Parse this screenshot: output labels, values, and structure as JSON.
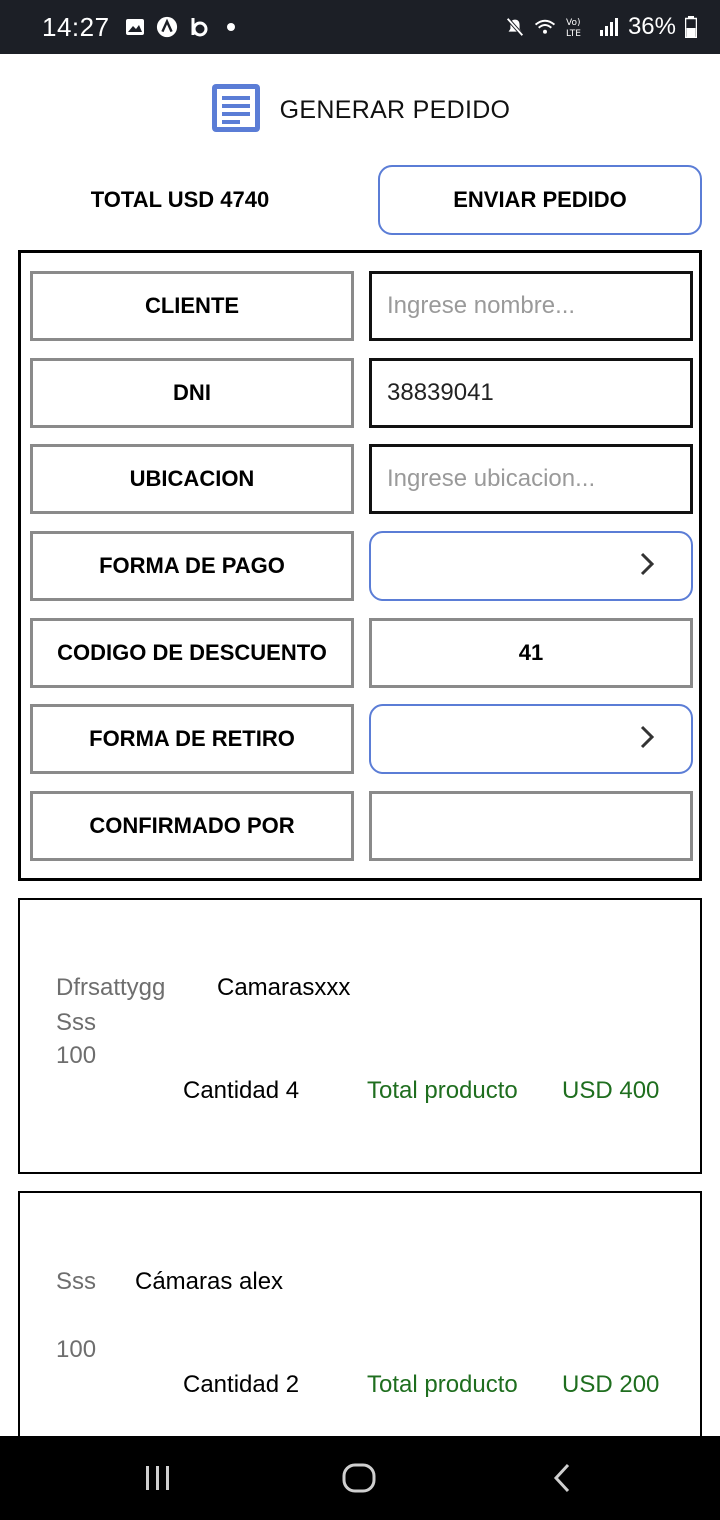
{
  "status_bar": {
    "time": "14:27",
    "battery": "36%",
    "left_icons": [
      "image-icon",
      "a-circle-icon",
      "b-icon",
      "dot-icon"
    ],
    "right_icons": [
      "mute-icon",
      "wifi-icon",
      "volte-icon",
      "signal-icon",
      "battery-icon"
    ]
  },
  "header": {
    "title": "GENERAR PEDIDO",
    "icon": "document-icon",
    "accent": "#5b7dd6"
  },
  "summary": {
    "total_label": "TOTAL USD 4740",
    "send_button": "ENVIAR PEDIDO"
  },
  "form": {
    "cliente": {
      "label": "CLIENTE",
      "placeholder": "Ingrese nombre..."
    },
    "dni": {
      "label": "DNI",
      "value": "38839041"
    },
    "ubicacion": {
      "label": "UBICACION",
      "placeholder": "Ingrese ubicacion..."
    },
    "forma_pago": {
      "label": "FORMA DE PAGO",
      "value": ""
    },
    "codigo_descuento": {
      "label": "CODIGO DE DESCUENTO",
      "value": "41"
    },
    "forma_retiro": {
      "label": "FORMA DE RETIRO",
      "value": ""
    },
    "confirmado_por": {
      "label": "CONFIRMADO POR",
      "value": ""
    }
  },
  "products": [
    {
      "line1": "Dfrsattygg",
      "name": "Camarasxxx",
      "line2": "Sss",
      "line3": "100",
      "quantity": "Cantidad 4",
      "total_label": "Total producto",
      "total_value": "USD 400"
    },
    {
      "line1": "Sss",
      "name": "Cámaras alex",
      "line3": "100",
      "quantity": "Cantidad 2",
      "total_label": "Total producto",
      "total_value": "USD 200"
    }
  ],
  "colors": {
    "accent": "#5b7dd6",
    "total_green": "#1f6e1f",
    "status_bar_bg": "#1c1f26"
  },
  "nav_bar": {
    "buttons": [
      "recents-icon",
      "home-icon",
      "back-icon"
    ]
  }
}
